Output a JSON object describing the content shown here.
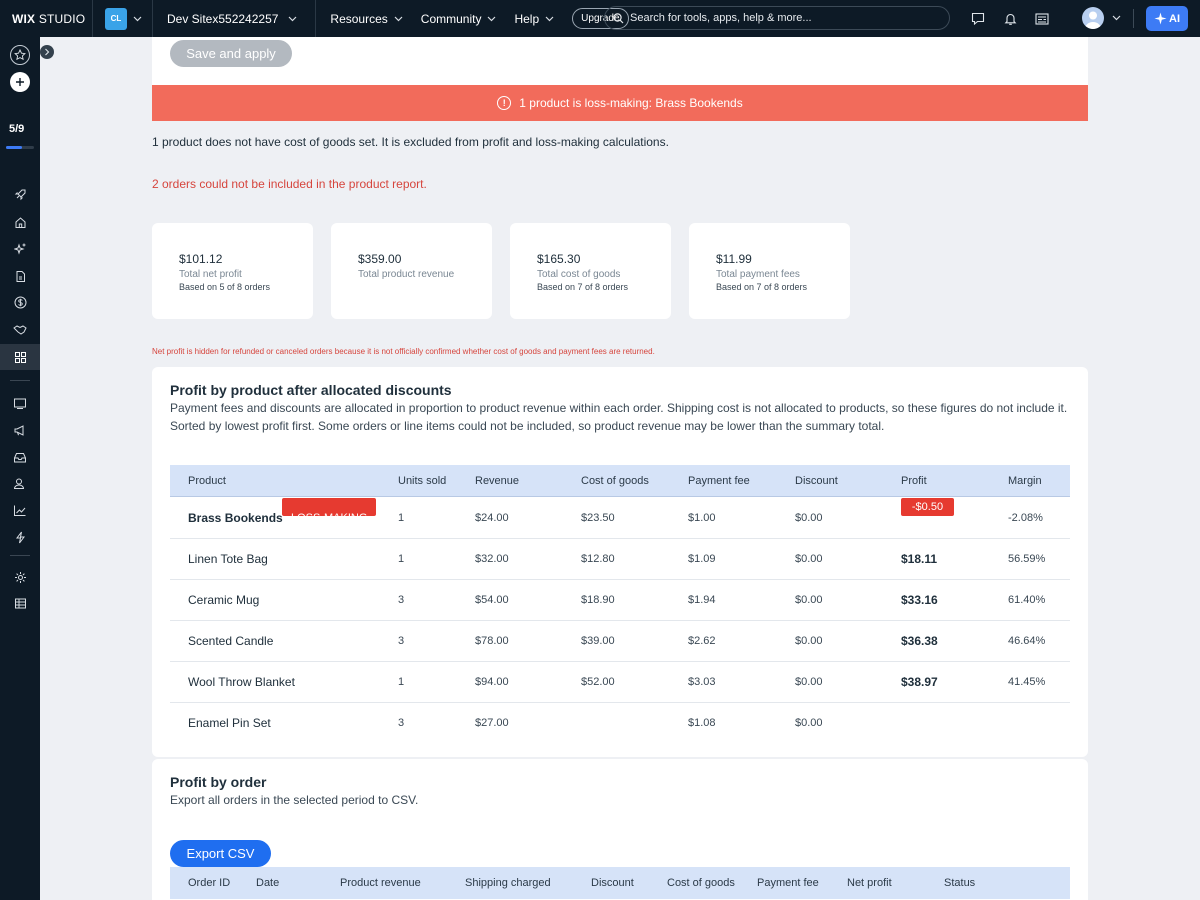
{
  "topbar": {
    "brand_bold": "WIX",
    "brand_light": "STUDIO",
    "workspace_initials": "CL",
    "site_name": "Dev Sitex552242257",
    "menu": [
      {
        "label": "Resources"
      },
      {
        "label": "Community"
      },
      {
        "label": "Help"
      }
    ],
    "upgrade_label": "Upgrade",
    "search_placeholder": "Search for tools, apps, help & more...",
    "ai_label": "AI"
  },
  "sidebar": {
    "progress_text": "5/9",
    "progress_fraction": 0.556
  },
  "actions": {
    "save_label": "Save and apply"
  },
  "alert": {
    "text": "1 product is loss-making: Brass Bookends",
    "icon_glyph": "!",
    "color": "#f26b5b"
  },
  "notes": {
    "cost_missing": "1 product does not have cost of goods set. It is excluded from profit and loss-making calculations.",
    "orders_excluded": "2 orders could not be included in the product report.",
    "net_profit_hidden": "Net profit is hidden for refunded or canceled orders because it is not officially confirmed whether cost of goods and payment fees are returned."
  },
  "summary_cards": [
    {
      "value": "$101.12",
      "label": "Total net profit",
      "sub": "Based on 5 of 8 orders"
    },
    {
      "value": "$359.00",
      "label": "Total product revenue",
      "sub": ""
    },
    {
      "value": "$165.30",
      "label": "Total cost of goods",
      "sub": "Based on 7 of 8 orders"
    },
    {
      "value": "$11.99",
      "label": "Total payment fees",
      "sub": "Based on 7 of 8 orders"
    }
  ],
  "product_section": {
    "title": "Profit by product after allocated discounts",
    "description": "Payment fees and discounts are allocated in proportion to product revenue within each order. Shipping cost is not allocated to products, so these figures do not include it. Sorted by lowest profit first. Some orders or line items could not be included, so product revenue may be lower than the summary total.",
    "columns": [
      "Product",
      "Units sold",
      "Revenue",
      "Cost of goods",
      "Payment fee",
      "Discount",
      "Profit",
      "Margin"
    ],
    "loss_badge": "LOSS-MAKING",
    "rows": [
      {
        "product": "Brass Bookends",
        "units": "1",
        "revenue": "$24.00",
        "cost": "$23.50",
        "fee": "$1.00",
        "discount": "$0.00",
        "profit": "-$0.50",
        "margin": "-2.08%"
      },
      {
        "product": "Linen Tote Bag",
        "units": "1",
        "revenue": "$32.00",
        "cost": "$12.80",
        "fee": "$1.09",
        "discount": "$0.00",
        "profit": "$18.11",
        "margin": "56.59%"
      },
      {
        "product": "Ceramic Mug",
        "units": "3",
        "revenue": "$54.00",
        "cost": "$18.90",
        "fee": "$1.94",
        "discount": "$0.00",
        "profit": "$33.16",
        "margin": "61.40%"
      },
      {
        "product": "Scented Candle",
        "units": "3",
        "revenue": "$78.00",
        "cost": "$39.00",
        "fee": "$2.62",
        "discount": "$0.00",
        "profit": "$36.38",
        "margin": "46.64%"
      },
      {
        "product": "Wool Throw Blanket",
        "units": "1",
        "revenue": "$94.00",
        "cost": "$52.00",
        "fee": "$3.03",
        "discount": "$0.00",
        "profit": "$38.97",
        "margin": "41.45%"
      },
      {
        "product": "Enamel Pin Set",
        "units": "3",
        "revenue": "$27.00",
        "cost": "",
        "fee": "$1.08",
        "discount": "$0.00",
        "profit": "",
        "margin": ""
      }
    ]
  },
  "order_section": {
    "title": "Profit by order",
    "description": "Export all orders in the selected period to CSV.",
    "export_label": "Export CSV",
    "columns": [
      "Order ID",
      "Date",
      "Product revenue",
      "Shipping charged",
      "Discount",
      "Cost of goods",
      "Payment fee",
      "Net profit",
      "Status"
    ]
  }
}
